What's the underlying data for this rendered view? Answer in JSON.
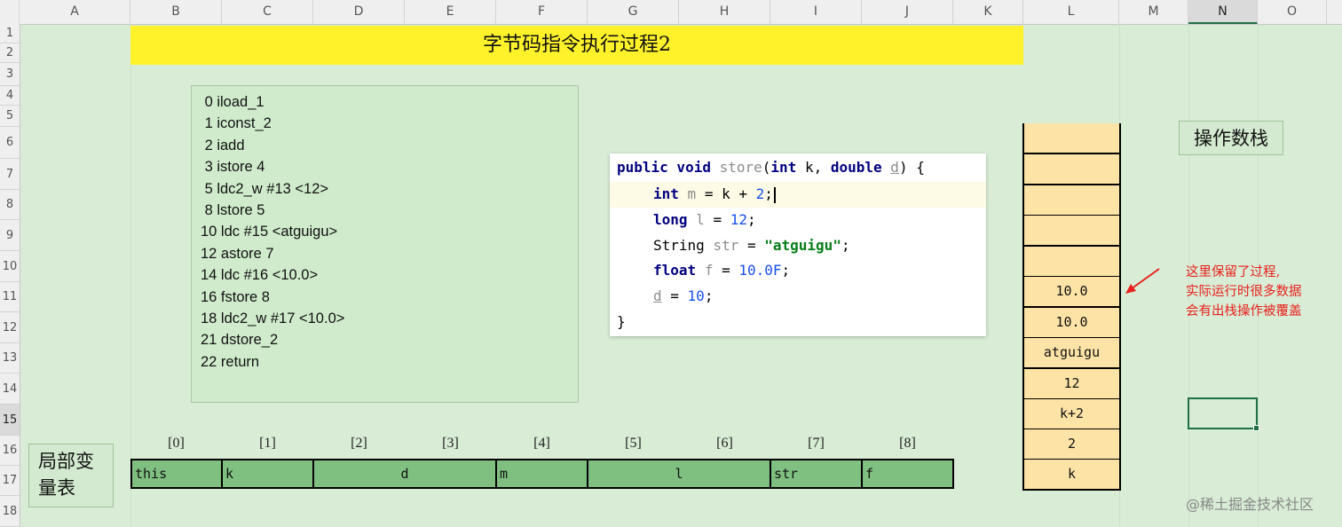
{
  "sheet": {
    "columns": [
      "A",
      "B",
      "C",
      "D",
      "E",
      "F",
      "G",
      "H",
      "I",
      "J",
      "K",
      "L",
      "M",
      "N",
      "O"
    ],
    "rows": [
      "1",
      "2",
      "3",
      "4",
      "5",
      "6",
      "7",
      "8",
      "9",
      "10",
      "11",
      "12",
      "13",
      "14",
      "15",
      "16",
      "17",
      "18"
    ],
    "selected_column": "N",
    "selected_row": "15"
  },
  "title": "字节码指令执行过程2",
  "bytecode": [
    " 0 iload_1",
    " 1 iconst_2",
    " 2 iadd",
    " 3 istore 4",
    " 5 ldc2_w #13 <12>",
    " 8 lstore 5",
    "10 ldc #15 <atguigu>",
    "12 astore 7",
    "14 ldc #16 <10.0>",
    "16 fstore 8",
    "18 ldc2_w #17 <10.0>",
    "21 dstore_2",
    "22 return"
  ],
  "code": {
    "l1": {
      "kw1": "public void",
      "name": "store",
      "p1": "(",
      "kw2": "int",
      "p2": " k, ",
      "kw3": "double",
      "sp": " ",
      "d": "d",
      "p3": ") {"
    },
    "l2": {
      "kw": "int",
      "sp": " ",
      "v": "m",
      "mid": " = k + ",
      "n": "2",
      "end": ";"
    },
    "l3": {
      "kw": "long",
      "sp": " ",
      "v": "l",
      "mid": " = ",
      "n": "12",
      "end": ";"
    },
    "l4": {
      "t": "String ",
      "v": "str",
      "mid": " = ",
      "s": "\"atguigu\"",
      "end": ";"
    },
    "l5": {
      "kw": "float",
      "sp": " ",
      "v": "f",
      "mid": " = ",
      "n": "10.0F",
      "end": ";"
    },
    "l6": {
      "v": "d",
      "mid": " = ",
      "n": "10",
      "end": ";"
    },
    "l7": "}"
  },
  "operand_stack": {
    "label": "操作数栈",
    "cells": [
      "",
      "",
      "",
      "",
      "",
      "10.0",
      "10.0",
      "atguigu",
      "12",
      "k+2",
      "2",
      "k"
    ]
  },
  "note": [
    "这里保留了过程,",
    "实际运行时很多数据",
    "会有出栈操作被覆盖"
  ],
  "local_vars": {
    "label_line1": "局部变",
    "label_line2": "量表",
    "indices": [
      "[0]",
      "[1]",
      "[2]",
      "[3]",
      "[4]",
      "[5]",
      "[6]",
      "[7]",
      "[8]"
    ],
    "cells": [
      "this",
      "k",
      "d",
      "m",
      "l",
      "str",
      "f"
    ]
  },
  "watermark": "@稀土掘金技术社区",
  "colors": {
    "title_bg": "#fff22b",
    "stack_cell": "#fde3a6",
    "lv_cell": "#7fbf80",
    "note": "#e8201b",
    "sheet_bg": "#d8ecd6"
  }
}
